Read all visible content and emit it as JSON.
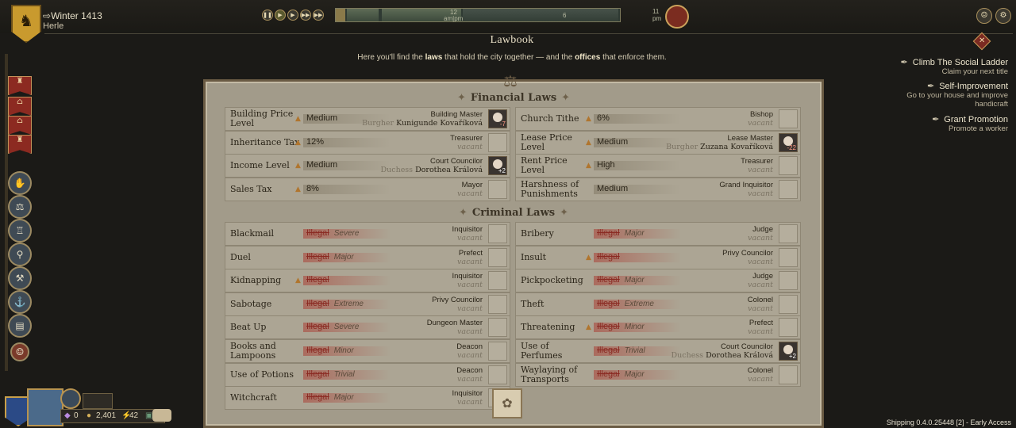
{
  "header": {
    "season": "Winter 1413",
    "city": "Herle",
    "timeline": {
      "label_12": "12",
      "label_ampm": "am|pm",
      "label_6": "6",
      "label_11": "11",
      "label_pm": "pm"
    }
  },
  "window": {
    "title": "Lawbook",
    "subtitle_pre": "Here you'll find the ",
    "subtitle_laws": "laws",
    "subtitle_mid": " that hold the city together — and the ",
    "subtitle_offices": "offices",
    "subtitle_post": " that enforce them."
  },
  "quests": [
    {
      "title": "Climb The Social Ladder",
      "desc": "Claim your next title"
    },
    {
      "title": "Self-Improvement",
      "desc": "Go to your house and improve handicraft"
    },
    {
      "title": "Grant Promotion",
      "desc": "Promote a worker"
    }
  ],
  "resources": {
    "a": "0",
    "b": "2,401",
    "c": "42"
  },
  "version": "Shipping 0.4.0.25448 [2] - Early Access",
  "sections": {
    "financial": "Financial Laws",
    "criminal": "Criminal Laws"
  },
  "financial_laws": [
    {
      "name": "Building Price Level",
      "level": "Medium",
      "warn": true,
      "office": "Building Master",
      "holder_rank": "Burgher",
      "holder": "Kunigunde Kovaříková",
      "badge": "-7"
    },
    {
      "name": "Church Tithe",
      "level": "6%",
      "warn": true,
      "office": "Bishop",
      "holder": "vacant"
    },
    {
      "name": "Inheritance Tax",
      "level": "12%",
      "warn": true,
      "office": "Treasurer",
      "holder": "vacant"
    },
    {
      "name": "Lease Price Level",
      "level": "Medium",
      "warn": true,
      "office": "Lease Master",
      "holder_rank": "Burgher",
      "holder": "Zuzana Kovaříková",
      "badge": "-22"
    },
    {
      "name": "Income Level",
      "level": "Medium",
      "warn": true,
      "office": "Court Councilor",
      "holder_rank": "Duchess",
      "holder": "Dorothea Králová",
      "badge": "+2"
    },
    {
      "name": "Rent Price Level",
      "level": "High",
      "warn": true,
      "office": "Treasurer",
      "holder": "vacant"
    },
    {
      "name": "Sales Tax",
      "level": "8%",
      "warn": true,
      "office": "Mayor",
      "holder": "vacant"
    },
    {
      "name": "Harshness of Punishments",
      "level": "Medium",
      "warn": false,
      "office": "Grand Inquisitor",
      "holder": "vacant"
    }
  ],
  "criminal_laws": [
    {
      "name": "Blackmail",
      "level": "Illegal",
      "severity": "Severe",
      "warn": false,
      "office": "Inquisitor",
      "holder": "vacant"
    },
    {
      "name": "Bribery",
      "level": "Illegal",
      "severity": "Major",
      "warn": false,
      "office": "Judge",
      "holder": "vacant"
    },
    {
      "name": "Duel",
      "level": "Illegal",
      "severity": "Major",
      "warn": false,
      "office": "Prefect",
      "holder": "vacant"
    },
    {
      "name": "Insult",
      "level": "Illegal",
      "severity": "",
      "warn": true,
      "office": "Privy Councilor",
      "holder": "vacant"
    },
    {
      "name": "Kidnapping",
      "level": "Illegal",
      "severity": "",
      "warn": true,
      "office": "Inquisitor",
      "holder": "vacant"
    },
    {
      "name": "Pickpocketing",
      "level": "Illegal",
      "severity": "Major",
      "warn": false,
      "office": "Judge",
      "holder": "vacant"
    },
    {
      "name": "Sabotage",
      "level": "Illegal",
      "severity": "Extreme",
      "warn": false,
      "office": "Privy Councilor",
      "holder": "vacant"
    },
    {
      "name": "Theft",
      "level": "Illegal",
      "severity": "Extreme",
      "warn": false,
      "office": "Colonel",
      "holder": "vacant"
    },
    {
      "name": "Beat Up",
      "level": "Illegal",
      "severity": "Severe",
      "warn": false,
      "office": "Dungeon Master",
      "holder": "vacant"
    },
    {
      "name": "Threatening",
      "level": "Illegal",
      "severity": "Minor",
      "warn": true,
      "office": "Prefect",
      "holder": "vacant"
    },
    {
      "name": "Books and Lampoons",
      "level": "Illegal",
      "severity": "Minor",
      "warn": false,
      "office": "Deacon",
      "holder": "vacant"
    },
    {
      "name": "Use of Perfumes",
      "level": "Illegal",
      "severity": "Trivial",
      "warn": false,
      "office": "Court Councilor",
      "holder_rank": "Duchess",
      "holder": "Dorothea Králová",
      "badge": "+2"
    },
    {
      "name": "Use of Potions",
      "level": "Illegal",
      "severity": "Trivial",
      "warn": false,
      "office": "Deacon",
      "holder": "vacant"
    },
    {
      "name": "Waylaying of Transports",
      "level": "Illegal",
      "severity": "Major",
      "warn": false,
      "office": "Colonel",
      "holder": "vacant"
    },
    {
      "name": "Witchcraft",
      "level": "Illegal",
      "severity": "Major",
      "warn": false,
      "office": "Inquisitor",
      "holder": "vacant"
    }
  ]
}
